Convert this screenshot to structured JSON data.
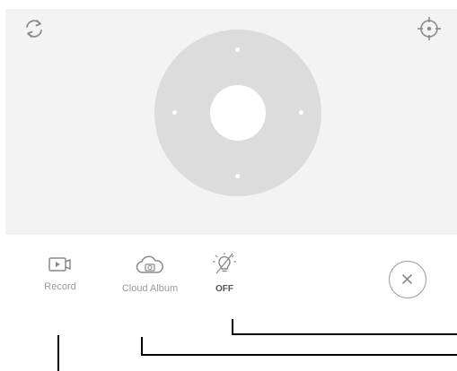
{
  "ptz": {
    "rotate_icon": "rotate-icon",
    "target_icon": "crosshair-icon",
    "dpad_directions": [
      "up",
      "down",
      "left",
      "right"
    ]
  },
  "toolbar": {
    "record": {
      "icon": "video-record-icon",
      "label": "Record"
    },
    "cloud_album": {
      "icon": "cloud-album-icon",
      "label": "Cloud Album"
    },
    "light": {
      "icon": "light-bulb-icon",
      "status": "OFF"
    },
    "close": {
      "icon": "close-icon"
    }
  },
  "colors": {
    "panel_bg": "#f3f3f3",
    "dpad": "#dcdcdc",
    "icon_gray": "#8a8a8a",
    "label_gray": "#9a9a9a",
    "callout": "#000000"
  }
}
